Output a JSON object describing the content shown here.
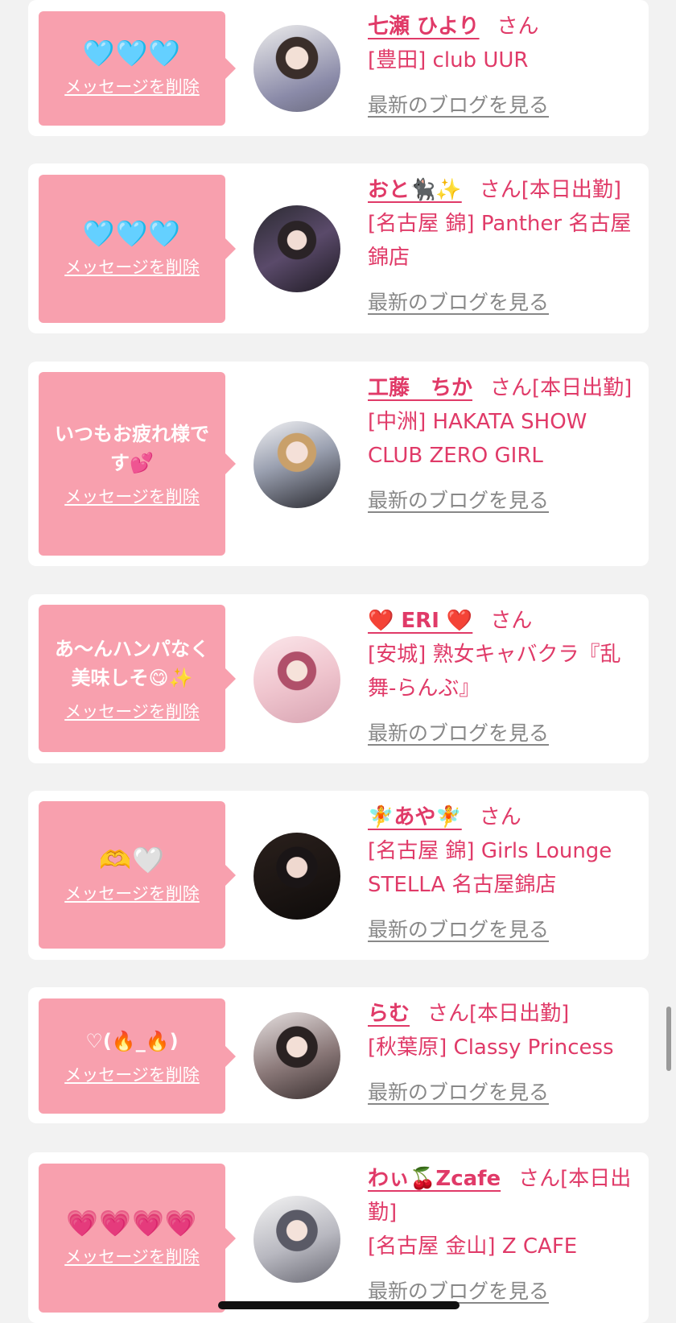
{
  "cards": [
    {
      "message": "🩵🩵🩵",
      "emoji": true,
      "delete_label": "メッセージを削除",
      "name": "七瀬 ひより",
      "san": "さん",
      "shop": "[豊田] club UUR",
      "blog_label": "最新のブログを見る"
    },
    {
      "message": "🩵🩵🩵",
      "emoji": true,
      "delete_label": "メッセージを削除",
      "name": "おと🐈‍⬛✨",
      "san": "さん[本日出勤]",
      "shop": "[名古屋 錦] Panther 名古屋錦店",
      "blog_label": "最新のブログを見る"
    },
    {
      "message": "いつもお疲れ様です💕",
      "emoji": false,
      "delete_label": "メッセージを削除",
      "name": "工藤　ちか",
      "san": "さん[本日出勤]",
      "shop": "[中洲] HAKATA SHOW CLUB ZERO GIRL",
      "blog_label": "最新のブログを見る"
    },
    {
      "message": "あ〜んハンパなく美味しそ😋✨",
      "emoji": false,
      "delete_label": "メッセージを削除",
      "name": "❤️ ERI ❤️",
      "san": "さん",
      "shop": "[安城] 熟女キャバクラ『乱舞-らんぶ』",
      "blog_label": "最新のブログを見る"
    },
    {
      "message": "🫶🤍",
      "emoji": true,
      "delete_label": "メッセージを削除",
      "name": "🧚あや🧚",
      "san": "さん",
      "shop": "[名古屋 錦] Girls Lounge STELLA 名古屋錦店",
      "blog_label": "最新のブログを見る"
    },
    {
      "message": "♡(🔥_🔥)",
      "emoji": false,
      "delete_label": "メッセージを削除",
      "name": "らむ",
      "san": "さん[本日出勤]",
      "shop": "[秋葉原] Classy Princess",
      "blog_label": "最新のブログを見る"
    },
    {
      "message": "💗💗💗💗",
      "emoji": true,
      "delete_label": "メッセージを削除",
      "name": "わぃ🍒Zcafe",
      "san": "さん[本日出勤]",
      "shop": "[名古屋 金山] Z CAFE",
      "blog_label": "最新のブログを見る"
    }
  ]
}
